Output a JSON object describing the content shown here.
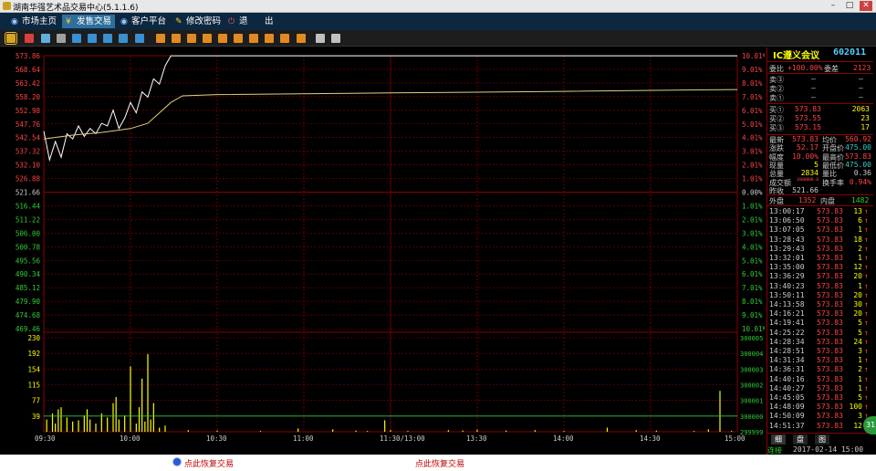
{
  "window": {
    "title": "湖南华强艺术品交易中心(5.1.1.6)",
    "min": "–",
    "max": "□",
    "close": "✕"
  },
  "nav": [
    {
      "label": "市场主页",
      "icon": "◉"
    },
    {
      "label": "发售交易",
      "icon": "¥"
    },
    {
      "label": "客户平台",
      "icon": "◉"
    },
    {
      "label": "修改密码",
      "icon": "✎"
    },
    {
      "label": "退",
      "icon": "⏻"
    },
    {
      "label": "出",
      "icon": ""
    }
  ],
  "toolbar_icons": [
    {
      "name": "bar-chart-icon",
      "color": "#d9a520"
    },
    {
      "name": "line-chart-icon",
      "color": "#d84040"
    },
    {
      "name": "candlestick-icon",
      "color": "#5fb0e0"
    },
    {
      "name": "table-icon",
      "color": "#a0a0a0"
    },
    {
      "name": "list-icon",
      "color": "#3a8fd0"
    },
    {
      "name": "grid-icon",
      "color": "#3a8fd0"
    },
    {
      "name": "window-icon",
      "color": "#3a8fd0"
    },
    {
      "name": "stack-icon",
      "color": "#3a8fd0"
    },
    {
      "name": "x-icon",
      "color": "#3a8fd0"
    },
    {
      "name": "order-icon",
      "color": "#e08a20"
    },
    {
      "name": "buy-icon",
      "color": "#e08a20"
    },
    {
      "name": "sell-icon",
      "color": "#e08a20"
    },
    {
      "name": "cancel-icon",
      "color": "#e08a20"
    },
    {
      "name": "query-icon",
      "color": "#e08a20"
    },
    {
      "name": "fund-icon",
      "color": "#e08a20"
    },
    {
      "name": "position-icon",
      "color": "#e08a20"
    },
    {
      "name": "deal-icon",
      "color": "#e08a20"
    },
    {
      "name": "history-icon",
      "color": "#e08a20"
    },
    {
      "name": "report-icon",
      "color": "#e08a20"
    },
    {
      "name": "pen-icon",
      "color": "#c0c0c0"
    },
    {
      "name": "settings-icon",
      "color": "#c0c0c0"
    }
  ],
  "chart_data": {
    "type": "line",
    "price_axis": [
      "573.86",
      "568.64",
      "563.42",
      "558.20",
      "552.98",
      "547.76",
      "542.54",
      "537.32",
      "532.10",
      "526.88",
      "521.66",
      "516.44",
      "511.22",
      "506.00",
      "500.78",
      "495.56",
      "490.34",
      "485.12",
      "479.90",
      "474.68",
      "469.46"
    ],
    "pct_axis": [
      "10.01%",
      "9.01%",
      "8.01%",
      "7.01%",
      "6.01%",
      "5.01%",
      "4.01%",
      "3.01%",
      "2.01%",
      "1.01%",
      "0.00%",
      "1.01%",
      "2.01%",
      "3.01%",
      "4.01%",
      "5.01%",
      "6.01%",
      "7.01%",
      "8.01%",
      "9.01%",
      "10.01%"
    ],
    "volume_axis": [
      "230",
      "192",
      "154",
      "115",
      "77",
      "39"
    ],
    "volume_right_axis": [
      "300005",
      "300004",
      "300003",
      "300002",
      "300001",
      "300000",
      "299999"
    ],
    "time_axis": [
      "09:30",
      "10:00",
      "10:30",
      "11:00",
      "11:30/13:00",
      "13:30",
      "14:00",
      "14:30",
      "15:00"
    ],
    "ylim_price": [
      469.46,
      573.86
    ],
    "ylim_volume": [
      0,
      230
    ],
    "price_series": {
      "name": "price",
      "points": [
        [
          0,
          545
        ],
        [
          2,
          534
        ],
        [
          4,
          541
        ],
        [
          6,
          535
        ],
        [
          8,
          544
        ],
        [
          10,
          542
        ],
        [
          12,
          547
        ],
        [
          14,
          543
        ],
        [
          16,
          546
        ],
        [
          18,
          544
        ],
        [
          20,
          548
        ],
        [
          22,
          547
        ],
        [
          24,
          553
        ],
        [
          26,
          546
        ],
        [
          28,
          550
        ],
        [
          30,
          556
        ],
        [
          32,
          552
        ],
        [
          34,
          560
        ],
        [
          36,
          558
        ],
        [
          38,
          565
        ],
        [
          40,
          563
        ],
        [
          42,
          570
        ],
        [
          44,
          573.83
        ],
        [
          60,
          573.83
        ],
        [
          120,
          573.83
        ],
        [
          240,
          573.83
        ]
      ]
    },
    "avg_series": {
      "name": "avg",
      "points": [
        [
          0,
          542
        ],
        [
          10,
          543.5
        ],
        [
          20,
          544.5
        ],
        [
          30,
          546
        ],
        [
          36,
          548
        ],
        [
          40,
          552
        ],
        [
          44,
          556
        ],
        [
          48,
          558.5
        ],
        [
          60,
          559
        ],
        [
          120,
          559.6
        ],
        [
          180,
          560.2
        ],
        [
          230,
          560.8
        ],
        [
          240,
          560.92
        ]
      ]
    },
    "volume": [
      [
        1,
        30
      ],
      [
        3,
        45
      ],
      [
        4,
        20
      ],
      [
        5,
        55
      ],
      [
        6,
        60
      ],
      [
        8,
        35
      ],
      [
        10,
        25
      ],
      [
        12,
        28
      ],
      [
        14,
        40
      ],
      [
        15,
        55
      ],
      [
        16,
        30
      ],
      [
        18,
        20
      ],
      [
        20,
        45
      ],
      [
        22,
        35
      ],
      [
        24,
        70
      ],
      [
        25,
        85
      ],
      [
        26,
        30
      ],
      [
        28,
        40
      ],
      [
        30,
        160
      ],
      [
        32,
        20
      ],
      [
        33,
        60
      ],
      [
        34,
        130
      ],
      [
        35,
        25
      ],
      [
        36,
        190
      ],
      [
        37,
        30
      ],
      [
        38,
        70
      ],
      [
        40,
        10
      ],
      [
        42,
        15
      ],
      [
        50,
        4
      ],
      [
        60,
        3
      ],
      [
        75,
        2
      ],
      [
        88,
        8
      ],
      [
        100,
        6
      ],
      [
        108,
        3
      ],
      [
        112,
        2
      ],
      [
        118,
        28
      ],
      [
        120,
        4
      ],
      [
        126,
        2
      ],
      [
        140,
        4
      ],
      [
        145,
        3
      ],
      [
        150,
        5
      ],
      [
        160,
        3
      ],
      [
        170,
        4
      ],
      [
        180,
        2
      ],
      [
        195,
        10
      ],
      [
        205,
        4
      ],
      [
        212,
        3
      ],
      [
        225,
        2
      ],
      [
        230,
        6
      ],
      [
        234,
        100
      ],
      [
        238,
        2
      ]
    ]
  },
  "stock": {
    "name": "IC遵义会议",
    "code": "602011"
  },
  "order_header": {
    "ratio_label": "委比",
    "ratio_value": "+100.00%",
    "diff_label": "委差",
    "diff_value": "2123"
  },
  "asks": [
    {
      "label": "卖③",
      "price": "—",
      "vol": "—"
    },
    {
      "label": "卖②",
      "price": "—",
      "vol": "—"
    },
    {
      "label": "卖①",
      "price": "—",
      "vol": "—"
    }
  ],
  "bids": [
    {
      "label": "买①",
      "price": "573.83",
      "vol": "2063"
    },
    {
      "label": "买②",
      "price": "573.55",
      "vol": "23"
    },
    {
      "label": "买③",
      "price": "573.15",
      "vol": "17"
    }
  ],
  "quote": [
    {
      "l1": "最新",
      "v1": "573.83",
      "l2": "均价",
      "v2": "560.92"
    },
    {
      "l1": "涨跌",
      "v1": "52.17",
      "l2": "开盘价",
      "v2": "475.00"
    },
    {
      "l1": "幅度",
      "v1": "10.00%",
      "l2": "最高价",
      "v2": "573.83"
    },
    {
      "l1": "现量",
      "v1": "5",
      "l2": "最低价",
      "v2": "475.00"
    },
    {
      "l1": "总量",
      "v1": "2834",
      "l2": "量比",
      "v2": "0.36"
    },
    {
      "l1": "成交额",
      "v1": "1600000.0",
      "l2": "换手率",
      "v2": "0.94%"
    },
    {
      "l1": "昨收",
      "v1": "521.66",
      "l2": "",
      "v2": ""
    }
  ],
  "outer_label": "外盘",
  "outer_value": "1352",
  "inner_label": "内盘",
  "inner_value": "1482",
  "ticks": [
    {
      "t": "13:00:17",
      "p": "573.83",
      "v": "13"
    },
    {
      "t": "13:06:50",
      "p": "573.83",
      "v": "6"
    },
    {
      "t": "13:07:05",
      "p": "573.83",
      "v": "1"
    },
    {
      "t": "13:28:43",
      "p": "573.83",
      "v": "18"
    },
    {
      "t": "13:29:43",
      "p": "573.83",
      "v": "2"
    },
    {
      "t": "13:32:01",
      "p": "573.83",
      "v": "1"
    },
    {
      "t": "13:35:00",
      "p": "573.83",
      "v": "12"
    },
    {
      "t": "13:36:29",
      "p": "573.83",
      "v": "20"
    },
    {
      "t": "13:40:23",
      "p": "573.83",
      "v": "1"
    },
    {
      "t": "13:50:11",
      "p": "573.83",
      "v": "20"
    },
    {
      "t": "14:13:58",
      "p": "573.83",
      "v": "30"
    },
    {
      "t": "14:16:21",
      "p": "573.83",
      "v": "20"
    },
    {
      "t": "14:19:41",
      "p": "573.83",
      "v": "5"
    },
    {
      "t": "14:25:22",
      "p": "573.83",
      "v": "5"
    },
    {
      "t": "14:28:34",
      "p": "573.83",
      "v": "24"
    },
    {
      "t": "14:28:51",
      "p": "573.83",
      "v": "3"
    },
    {
      "t": "14:31:34",
      "p": "573.83",
      "v": "1"
    },
    {
      "t": "14:36:31",
      "p": "573.83",
      "v": "2"
    },
    {
      "t": "14:40:16",
      "p": "573.83",
      "v": "1"
    },
    {
      "t": "14:40:27",
      "p": "573.83",
      "v": "1"
    },
    {
      "t": "14:45:05",
      "p": "573.83",
      "v": "5"
    },
    {
      "t": "14:48:09",
      "p": "573.83",
      "v": "100"
    },
    {
      "t": "14:50:09",
      "p": "573.83",
      "v": "3"
    },
    {
      "t": "14:51:37",
      "p": "573.83",
      "v": "12"
    }
  ],
  "tick_arrow": "↑",
  "bottom_tabs": [
    "细",
    "盘",
    "图"
  ],
  "connection": {
    "label": "连接",
    "datetime": "2017-02-14 15:00"
  },
  "status": {
    "msg1": "点此恢复交易",
    "msg2": "点此恢复交易"
  },
  "float_badge": "31"
}
